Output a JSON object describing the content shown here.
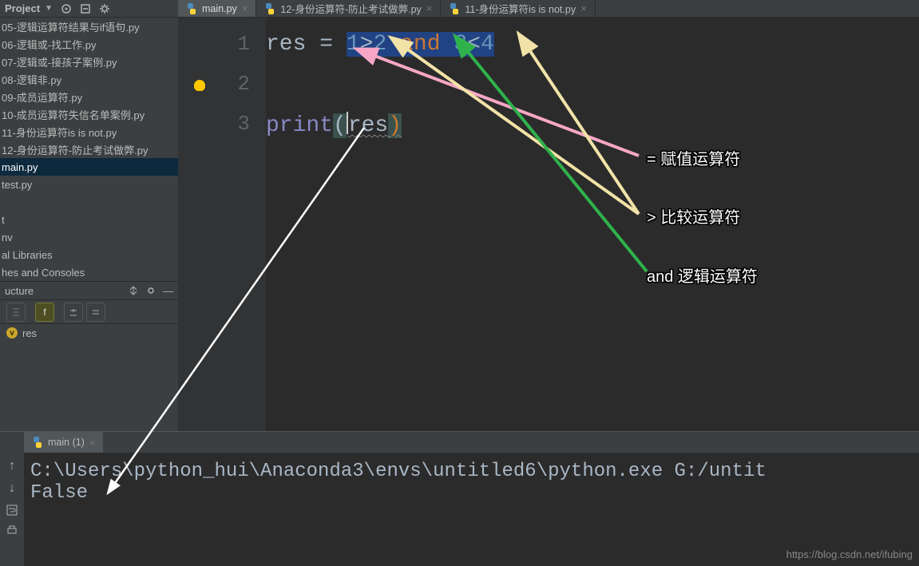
{
  "project_label": "Project",
  "files": [
    "05-逻辑运算符结果与if语句.py",
    "06-逻辑或-找工作.py",
    "07-逻辑或-接孩子案例.py",
    "08-逻辑非.py",
    "09-成员运算符.py",
    "10-成员运算符失信名单案例.py",
    "11-身份运算符is is not.py",
    "12-身份运算符-防止考试做弊.py",
    "main.py",
    "test.py"
  ],
  "selected_file_index": 8,
  "extra_items": [
    "t",
    "nv",
    "al Libraries",
    "hes and Consoles"
  ],
  "structure_label": "ucture",
  "structure_var": "res",
  "tabs": [
    {
      "label": "main.py",
      "active": true
    },
    {
      "label": "12-身份运算符-防止考试做弊.py",
      "active": false
    },
    {
      "label": "11-身份运算符is is not.py",
      "active": false
    }
  ],
  "code": {
    "line1": {
      "var": "res",
      "eq": " = ",
      "sel_part": "1>2 and 3<4"
    },
    "line3": {
      "fn": "print",
      "paren_open": "(",
      "arg": "res",
      "paren_close": ")"
    }
  },
  "line_numbers": [
    "1",
    "2",
    "3"
  ],
  "console_tab": "main (1)",
  "console_output_line1": "C:\\Users\\python_hui\\Anaconda3\\envs\\untitled6\\python.exe G:/untit",
  "console_output_line2": "False",
  "annotations": {
    "assign": "= 赋值运算符",
    "compare": "> 比较运算符",
    "logic": "and 逻辑运算符"
  },
  "watermark": "https://blog.csdn.net/ifubing"
}
